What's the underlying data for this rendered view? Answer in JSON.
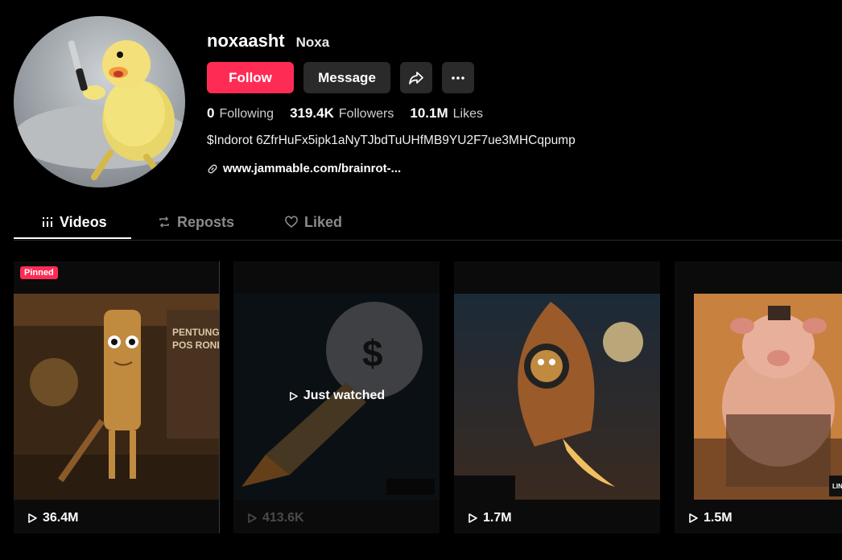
{
  "profile": {
    "username": "noxaasht",
    "nickname": "Noxa",
    "bio": "$Indorot 6ZfrHuFx5ipk1aNyTJbdTuUHfMB9YU2F7ue3MHCqpump",
    "link": "www.jammable.com/brainrot-..."
  },
  "actions": {
    "follow": "Follow",
    "message": "Message"
  },
  "stats": [
    {
      "value": "0",
      "label": "Following"
    },
    {
      "value": "319.4K",
      "label": "Followers"
    },
    {
      "value": "10.1M",
      "label": "Likes"
    }
  ],
  "tabs": {
    "videos": "Videos",
    "reposts": "Reposts",
    "liked": "Liked"
  },
  "videos": [
    {
      "views": "36.4M",
      "badge": "Pinned",
      "sign_text_1": "PENTUNGA",
      "sign_text_2": "POS RONDA"
    },
    {
      "views": "413.6K",
      "overlay": "Just watched"
    },
    {
      "views": "1.7M"
    },
    {
      "views": "1.5M",
      "corner_text": "LINK"
    }
  ],
  "colors": {
    "accent": "#fe2c55",
    "button_bg": "#2a2a2a",
    "background": "#000000"
  }
}
